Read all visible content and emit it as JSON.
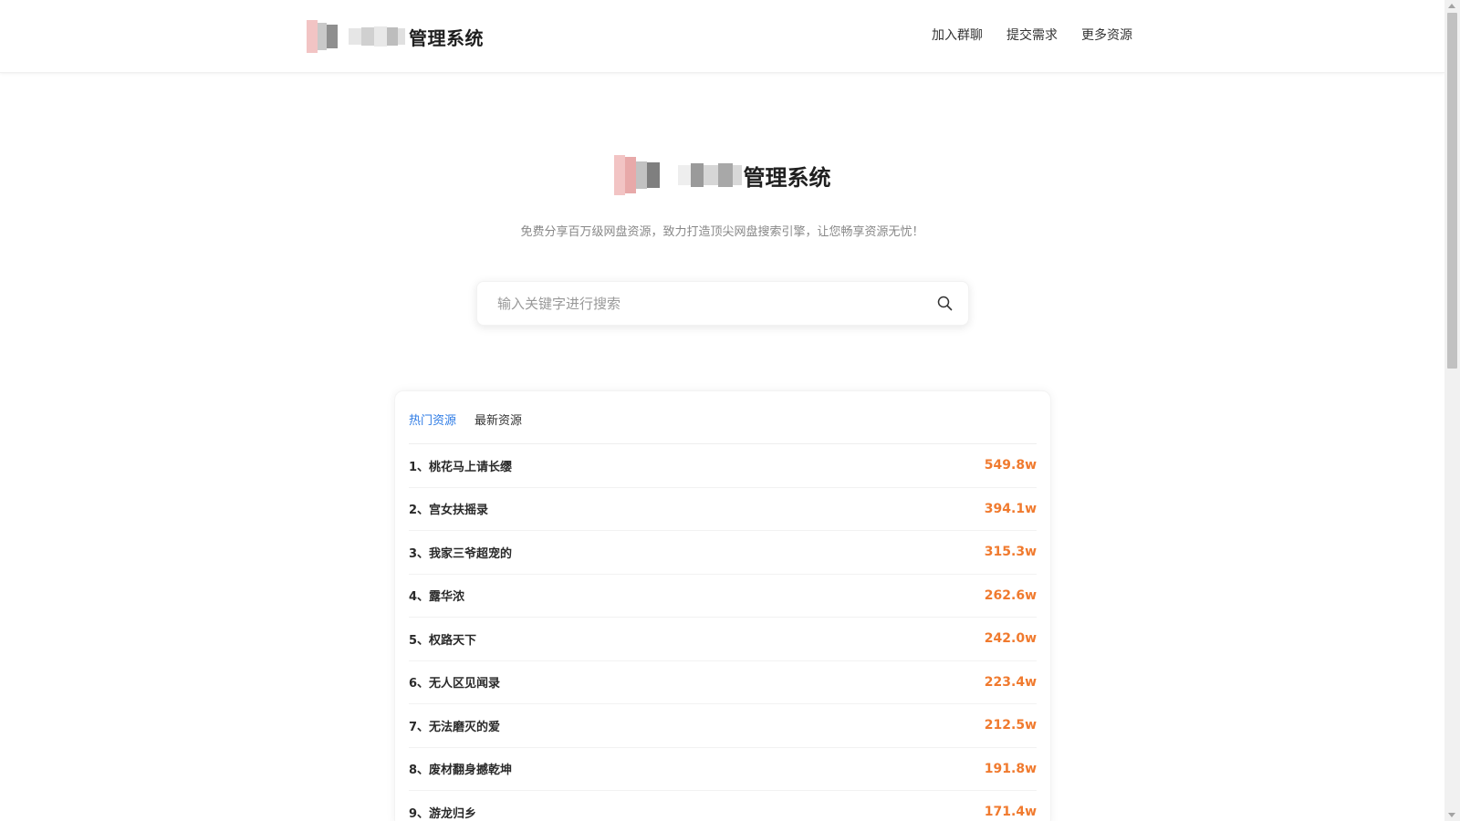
{
  "header": {
    "title": "管理系统",
    "nav": [
      {
        "label": "加入群聊"
      },
      {
        "label": "提交需求"
      },
      {
        "label": "更多资源"
      }
    ]
  },
  "hero": {
    "title": "管理系统",
    "tagline": "免费分享百万级网盘资源，致力打造顶尖网盘搜索引擎，让您畅享资源无忧！"
  },
  "search": {
    "placeholder": "输入关键字进行搜索",
    "icon": "search-icon"
  },
  "tabs": [
    {
      "label": "热门资源",
      "active": true
    },
    {
      "label": "最新资源",
      "active": false
    }
  ],
  "resources": [
    {
      "name": "1、桃花马上请长缨",
      "count": "549.8w"
    },
    {
      "name": "2、宫女扶摇录",
      "count": "394.1w"
    },
    {
      "name": "3、我家三爷超宠的",
      "count": "315.3w"
    },
    {
      "name": "4、露华浓",
      "count": "262.6w"
    },
    {
      "name": "5、权路天下",
      "count": "242.0w"
    },
    {
      "name": "6、无人区见闻录",
      "count": "223.4w"
    },
    {
      "name": "7、无法磨灭的爱",
      "count": "212.5w"
    },
    {
      "name": "8、废材翻身撼乾坤",
      "count": "191.8w"
    },
    {
      "name": "9、游龙归乡",
      "count": "171.4w"
    }
  ],
  "colors": {
    "accent": "#2d7be5",
    "count": "#f07a2e"
  }
}
